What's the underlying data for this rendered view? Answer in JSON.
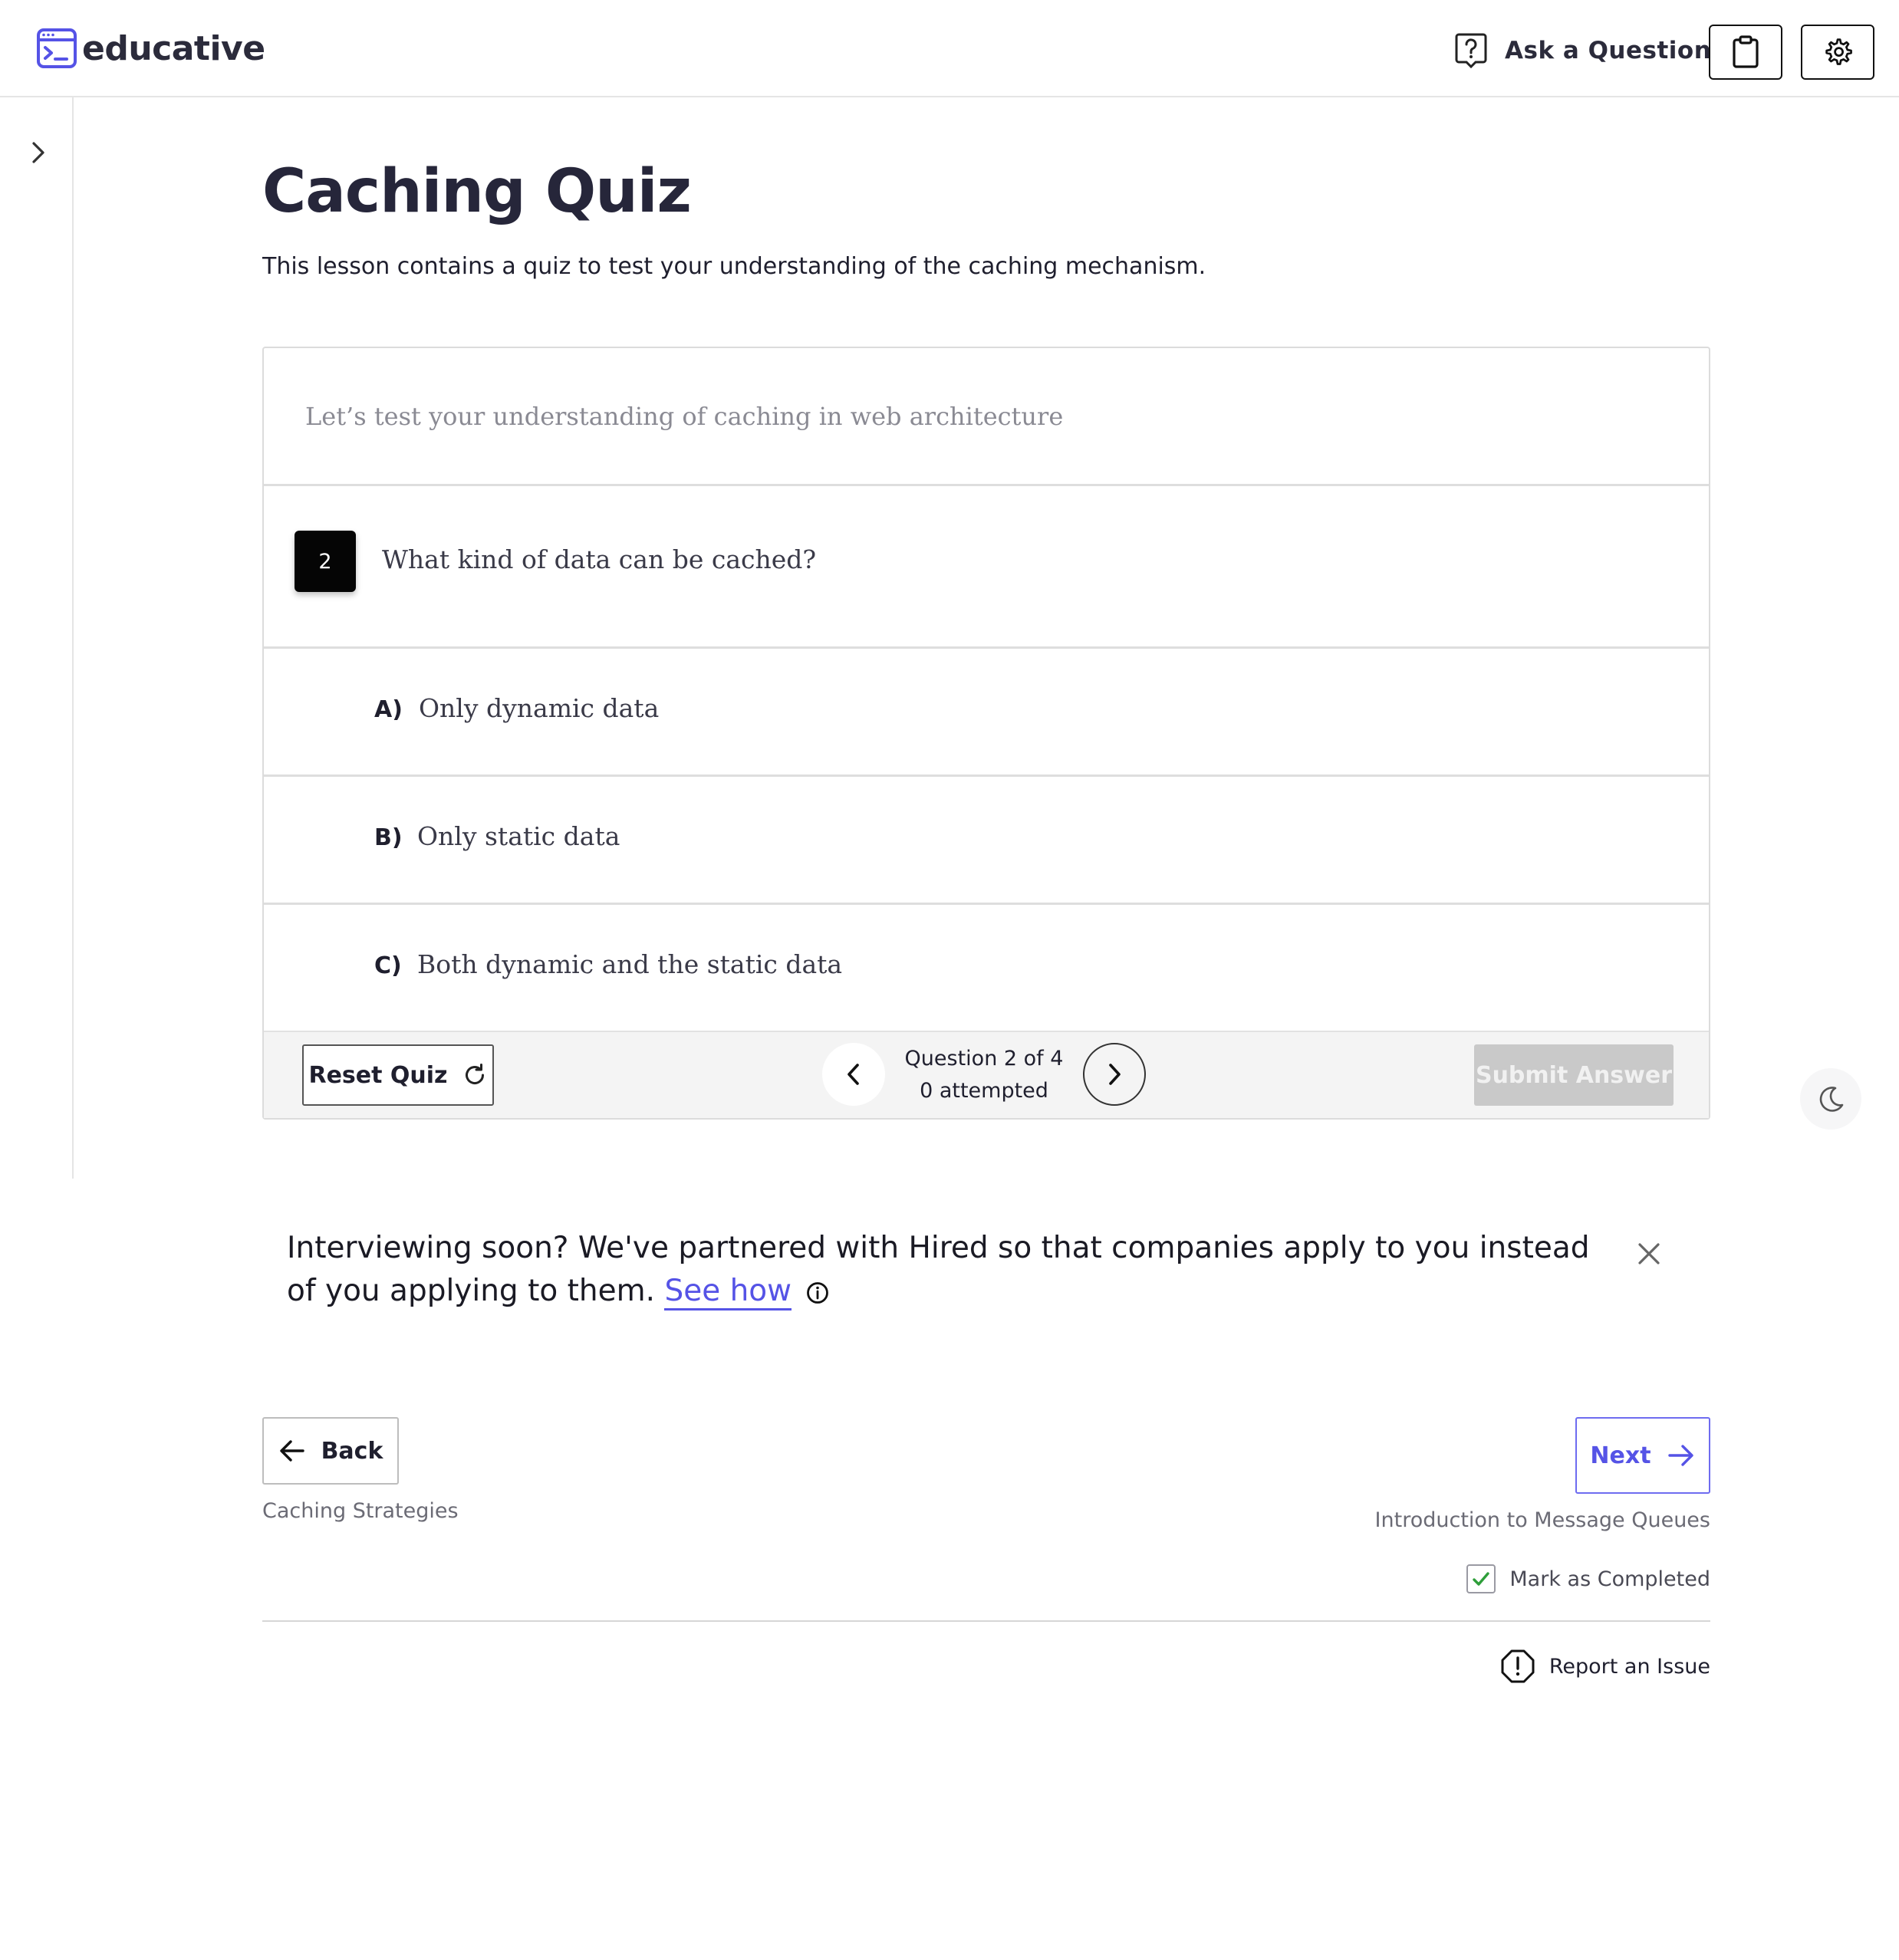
{
  "header": {
    "logo_text": "educative",
    "ask_label": "Ask a Question",
    "brand_color": "#5553e6"
  },
  "lesson": {
    "title": "Caching Quiz",
    "subtitle": "This lesson contains a quiz to test your understanding of the caching mechanism."
  },
  "quiz": {
    "intro": "Let’s test your understanding of caching in web architecture",
    "question_number": "2",
    "question_text": "What kind of data can be cached?",
    "options": [
      {
        "letter": "A)",
        "text": "Only dynamic data"
      },
      {
        "letter": "B)",
        "text": "Only static data"
      },
      {
        "letter": "C)",
        "text": "Both dynamic and the static data"
      }
    ],
    "reset_label": "Reset Quiz",
    "progress_label": "Question 2 of 4",
    "attempted_label": "0 attempted",
    "submit_label": "Submit Answer"
  },
  "promo": {
    "text": "Interviewing soon? We've partnered with Hired so that companies apply to you instead of you applying to them.",
    "link_label": "See how"
  },
  "navigation": {
    "back_label": "Back",
    "back_lesson": "Caching Strategies",
    "next_label": "Next",
    "next_lesson": "Introduction to Message Queues",
    "mark_completed_label": "Mark as Completed",
    "mark_completed_checked": true,
    "report_label": "Report an Issue"
  },
  "icons": {
    "ask": "question-file-icon",
    "clipboard": "clipboard-icon",
    "settings": "gear-icon",
    "sidebar": "chevron-right-icon",
    "reset": "refresh-icon",
    "theme": "moon-icon",
    "close": "close-icon",
    "info": "info-icon",
    "back": "arrow-left-icon",
    "next": "arrow-right-icon",
    "report": "alert-octagon-icon"
  }
}
